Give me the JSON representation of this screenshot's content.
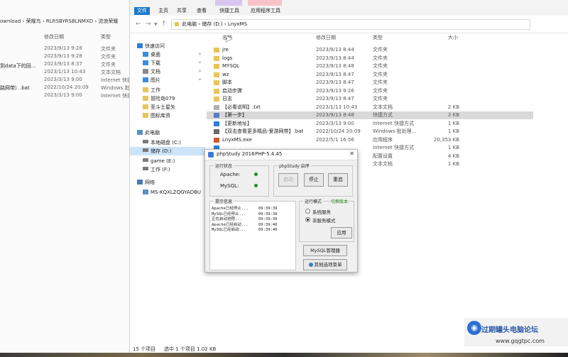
{
  "background_window": {
    "breadcrumb": "ownload  ›  荣耀鸟  ›  RLRSBYRSBLNMXD  ›  流浪荣耀",
    "headers": [
      "修改日期",
      "类型"
    ],
    "rows": [
      {
        "name": "",
        "date": "2023/9/13 9:28",
        "type": "文件夹"
      },
      {
        "name": "",
        "date": "2023/9/13 9:28",
        "type": "文件夹"
      },
      {
        "name": "",
        "date": "2023/9/13 8:37",
        "type": "文件夹"
      },
      {
        "name": "",
        "date": "2023/1/13 10:43",
        "type": "文本文档"
      },
      {
        "name": "",
        "date": "2023/3/13 9:00",
        "type": "Internet 快捷"
      },
      {
        "name": "路网带）.bat",
        "date": "2022/10/24 20:09",
        "type": "Windows 批"
      },
      {
        "name": "",
        "date": "2023/3/13 9:00",
        "type": "Internet 快捷"
      }
    ],
    "partial_label": "到data下的回..."
  },
  "ribbon": {
    "tabs": [
      "文件",
      "主页",
      "共享",
      "查看"
    ],
    "context_tabs": [
      "快捷工具",
      "应用程序工具"
    ],
    "context_headers": [
      "管理",
      "管理"
    ]
  },
  "address": {
    "path": "此电脑  ›  储存 (D:)  ›  LnyxMS"
  },
  "nav_pane": {
    "items": [
      {
        "label": "快速访问",
        "icon": "star-icon",
        "pinned": false
      },
      {
        "label": "桌面",
        "icon": "desktop-icon",
        "pinned": true
      },
      {
        "label": "下载",
        "icon": "download-icon",
        "pinned": true
      },
      {
        "label": "文档",
        "icon": "document-icon",
        "pinned": true
      },
      {
        "label": "图片",
        "icon": "picture-icon",
        "pinned": true
      },
      {
        "label": "工作",
        "icon": "folder-icon",
        "pinned": false
      },
      {
        "label": "冒险岛079",
        "icon": "folder-icon",
        "pinned": false
      },
      {
        "label": "圣斗士星矢",
        "icon": "folder-icon",
        "pinned": false
      },
      {
        "label": "图标库资",
        "icon": "folder-icon",
        "pinned": false
      },
      {
        "label": "此电脑",
        "icon": "computer-icon",
        "pinned": false
      },
      {
        "label": "本地磁盘 (C:)",
        "icon": "drive-icon",
        "pinned": false
      },
      {
        "label": "储存 (D:)",
        "icon": "drive-icon",
        "pinned": false
      },
      {
        "label": "game (E:)",
        "icon": "drive-icon",
        "pinned": false
      },
      {
        "label": "工作 (F:)",
        "icon": "drive-icon",
        "pinned": false
      },
      {
        "label": "网络",
        "icon": "network-icon",
        "pinned": false
      },
      {
        "label": "MS-KQXLZQGYADBU",
        "icon": "computer-icon",
        "pinned": false
      }
    ]
  },
  "file_list": {
    "headers": [
      "名称",
      "修改日期",
      "类型",
      "大小"
    ],
    "rows": [
      {
        "name": "jre",
        "date": "2023/9/13 8:44",
        "type": "文件夹",
        "size": "",
        "icon": "folder-icon"
      },
      {
        "name": "logs",
        "date": "2023/9/13 8:44",
        "type": "文件夹",
        "size": "",
        "icon": "folder-icon"
      },
      {
        "name": "MYSQL",
        "date": "2023/9/13 8:48",
        "type": "文件夹",
        "size": "",
        "icon": "folder-icon"
      },
      {
        "name": "wz",
        "date": "2023/9/13 8:47",
        "type": "文件夹",
        "size": "",
        "icon": "folder-icon"
      },
      {
        "name": "脚本",
        "date": "2023/9/13 8:47",
        "type": "文件夹",
        "size": "",
        "icon": "folder-icon"
      },
      {
        "name": "启动步骤",
        "date": "2023/9/13 9:26",
        "type": "文件夹",
        "size": "",
        "icon": "folder-icon"
      },
      {
        "name": "日志",
        "date": "2023/9/13 8:47",
        "type": "文件夹",
        "size": "",
        "icon": "folder-icon"
      },
      {
        "name": "【必看说明】.txt",
        "date": "2023/1/13 10:43",
        "type": "文本文档",
        "size": "2 KB",
        "icon": "text-file-icon"
      },
      {
        "name": "【第一步】",
        "date": "2023/9/13 8:48",
        "type": "快捷方式",
        "size": "2 KB",
        "icon": "shortcut-icon",
        "selected": true
      },
      {
        "name": "【更新地址】",
        "date": "2023/3/13 9:00",
        "type": "Internet 快捷方式",
        "size": "1 KB",
        "icon": "internet-shortcut-icon"
      },
      {
        "name": "【双击查看更多精品-爱游网带】.bat",
        "date": "2022/10/24 20:09",
        "type": "Windows 批处理...",
        "size": "1 KB",
        "icon": "batch-file-icon"
      },
      {
        "name": "LnyxMS.exe",
        "date": "2022/5/1 16:56",
        "type": "应用程序",
        "size": "20,353 KB",
        "icon": "exe-icon"
      },
      {
        "name": "",
        "date": "",
        "type": "Internet 快捷方式",
        "size": "1 KB",
        "icon": "internet-shortcut-icon"
      },
      {
        "name": "",
        "date": "",
        "type": "配置设置",
        "size": "4 KB",
        "icon": "config-icon"
      },
      {
        "name": "",
        "date": "",
        "type": "文本文档",
        "size": "1 KB",
        "icon": "text-file-icon"
      }
    ]
  },
  "status_bar": {
    "count": "15 个项目",
    "selected": "选中 1 个项目  1.02 KB"
  },
  "phpstudy": {
    "title": "phpStudy 2016",
    "version": "PHP-5.4.45",
    "status_group": "运行状态",
    "apache_label": "Apache:",
    "mysql_label": "MySQL:",
    "control_group": "phpStudy 启停",
    "start_btn": "启动",
    "stop_btn": "停止",
    "restart_btn": "重启",
    "log_group": "提示信息",
    "logs": [
      {
        "msg": "Apache已经停止...",
        "time": "09:39:39"
      },
      {
        "msg": "MySQL已经停止...",
        "time": "09:39:39"
      },
      {
        "msg": "正在启动进程...",
        "time": "09:39:39"
      },
      {
        "msg": "Apache已经启动...",
        "time": "09:39:40"
      },
      {
        "msg": "MySQL已经启动...",
        "time": "09:39:40"
      }
    ],
    "mode_group": "运行模式",
    "switch_version": "切换版本",
    "mode_options": [
      "系统服务",
      "非服务模式"
    ],
    "mode_selected_index": 1,
    "apply_btn": "应用",
    "mysql_manager_btn": "MySQL管理器",
    "other_menu_btn": "其他选项菜单",
    "status_color": "#1e8f2f"
  },
  "watermark": {
    "line1": "过期罐头电脑论坛",
    "line2": "www.gqgtpc.com"
  }
}
